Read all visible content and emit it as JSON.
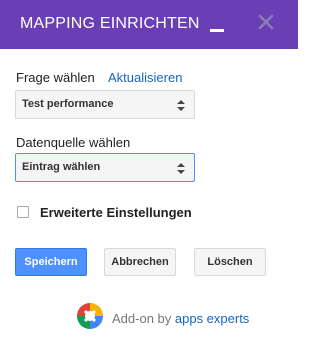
{
  "header": {
    "title": "MAPPING EINRICHTEN",
    "accent_color": "#6a3fb6",
    "minimize_icon": "minimize-icon",
    "close_icon": "close-icon"
  },
  "question": {
    "label": "Frage wählen",
    "refresh_link": "Aktualisieren",
    "selected_value": "Test performance"
  },
  "datasource": {
    "label": "Datenquelle wählen",
    "selected_value": "Eintrag wählen"
  },
  "advanced": {
    "label": "Erweiterte Einstellungen",
    "checked": false
  },
  "buttons": {
    "save": "Speichern",
    "cancel": "Abbrechen",
    "delete": "Löschen"
  },
  "footer": {
    "prefix": "Add-on by ",
    "link_text": "apps experts",
    "logo_icon": "apps-experts-logo"
  }
}
